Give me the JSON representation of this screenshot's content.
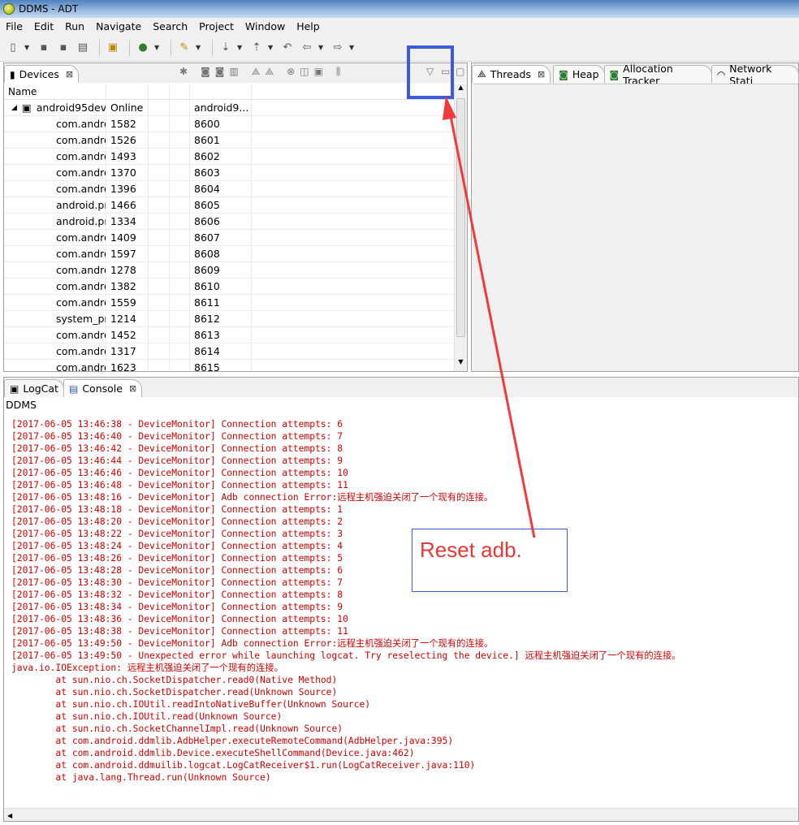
{
  "window": {
    "title": "DDMS - ADT"
  },
  "menu": [
    "File",
    "Edit",
    "Run",
    "Navigate",
    "Search",
    "Project",
    "Window",
    "Help"
  ],
  "devices_view": {
    "tab_label": "Devices",
    "columns": [
      "Name",
      "",
      "",
      "",
      "",
      ""
    ],
    "device": {
      "name": "android95dev",
      "status": "Online",
      "serial": "android9..."
    },
    "processes": [
      {
        "name": "com.andro",
        "pid": "1582",
        "port": "8600"
      },
      {
        "name": "com.andro",
        "pid": "1526",
        "port": "8601"
      },
      {
        "name": "com.andro",
        "pid": "1493",
        "port": "8602"
      },
      {
        "name": "com.andro",
        "pid": "1370",
        "port": "8603"
      },
      {
        "name": "com.andro",
        "pid": "1396",
        "port": "8604"
      },
      {
        "name": "android.pr",
        "pid": "1466",
        "port": "8605"
      },
      {
        "name": "android.pr",
        "pid": "1334",
        "port": "8606"
      },
      {
        "name": "com.andro",
        "pid": "1409",
        "port": "8607"
      },
      {
        "name": "com.andro",
        "pid": "1597",
        "port": "8608"
      },
      {
        "name": "com.andro",
        "pid": "1278",
        "port": "8609"
      },
      {
        "name": "com.andro",
        "pid": "1382",
        "port": "8610"
      },
      {
        "name": "com.andro",
        "pid": "1559",
        "port": "8611"
      },
      {
        "name": "system_prc",
        "pid": "1214",
        "port": "8612"
      },
      {
        "name": "com.andro",
        "pid": "1452",
        "port": "8613"
      },
      {
        "name": "com.andro",
        "pid": "1317",
        "port": "8614"
      },
      {
        "name": "com.andro",
        "pid": "1623",
        "port": "8615"
      }
    ]
  },
  "right_tabs": [
    "Threads",
    "Heap",
    "Allocation Tracker",
    "Network Stati"
  ],
  "bottom_tabs": [
    "LogCat",
    "Console"
  ],
  "console": {
    "label": "DDMS",
    "lines": [
      "[2017-06-05 13:46:38 - DeviceMonitor] Connection attempts: 6",
      "[2017-06-05 13:46:40 - DeviceMonitor] Connection attempts: 7",
      "[2017-06-05 13:46:42 - DeviceMonitor] Connection attempts: 8",
      "[2017-06-05 13:46:44 - DeviceMonitor] Connection attempts: 9",
      "[2017-06-05 13:46:46 - DeviceMonitor] Connection attempts: 10",
      "[2017-06-05 13:46:48 - DeviceMonitor] Connection attempts: 11",
      "[2017-06-05 13:48:16 - DeviceMonitor] Adb connection Error:远程主机强迫关闭了一个现有的连接。",
      "[2017-06-05 13:48:18 - DeviceMonitor] Connection attempts: 1",
      "[2017-06-05 13:48:20 - DeviceMonitor] Connection attempts: 2",
      "[2017-06-05 13:48:22 - DeviceMonitor] Connection attempts: 3",
      "[2017-06-05 13:48:24 - DeviceMonitor] Connection attempts: 4",
      "[2017-06-05 13:48:26 - DeviceMonitor] Connection attempts: 5",
      "[2017-06-05 13:48:28 - DeviceMonitor] Connection attempts: 6",
      "[2017-06-05 13:48:30 - DeviceMonitor] Connection attempts: 7",
      "[2017-06-05 13:48:32 - DeviceMonitor] Connection attempts: 8",
      "[2017-06-05 13:48:34 - DeviceMonitor] Connection attempts: 9",
      "[2017-06-05 13:48:36 - DeviceMonitor] Connection attempts: 10",
      "[2017-06-05 13:48:38 - DeviceMonitor] Connection attempts: 11",
      "[2017-06-05 13:49:50 - DeviceMonitor] Adb connection Error:远程主机强迫关闭了一个现有的连接。",
      "[2017-06-05 13:49:50 - Unexpected error while launching logcat. Try reselecting the device.] 远程主机强迫关闭了一个现有的连接。",
      "java.io.IOException: 远程主机强迫关闭了一个现有的连接。",
      "\tat sun.nio.ch.SocketDispatcher.read0(Native Method)",
      "\tat sun.nio.ch.SocketDispatcher.read(Unknown Source)",
      "\tat sun.nio.ch.IOUtil.readIntoNativeBuffer(Unknown Source)",
      "\tat sun.nio.ch.IOUtil.read(Unknown Source)",
      "\tat sun.nio.ch.SocketChannelImpl.read(Unknown Source)",
      "\tat com.android.ddmlib.AdbHelper.executeRemoteCommand(AdbHelper.java:395)",
      "\tat com.android.ddmlib.Device.executeShellCommand(Device.java:462)",
      "\tat com.android.ddmuilib.logcat.LogCatReceiver$1.run(LogCatReceiver.java:110)",
      "\tat java.lang.Thread.run(Unknown Source)"
    ]
  },
  "annotation": {
    "text": "Reset adb.",
    "color": "#e53935",
    "box_color": "#3b5bdb"
  }
}
